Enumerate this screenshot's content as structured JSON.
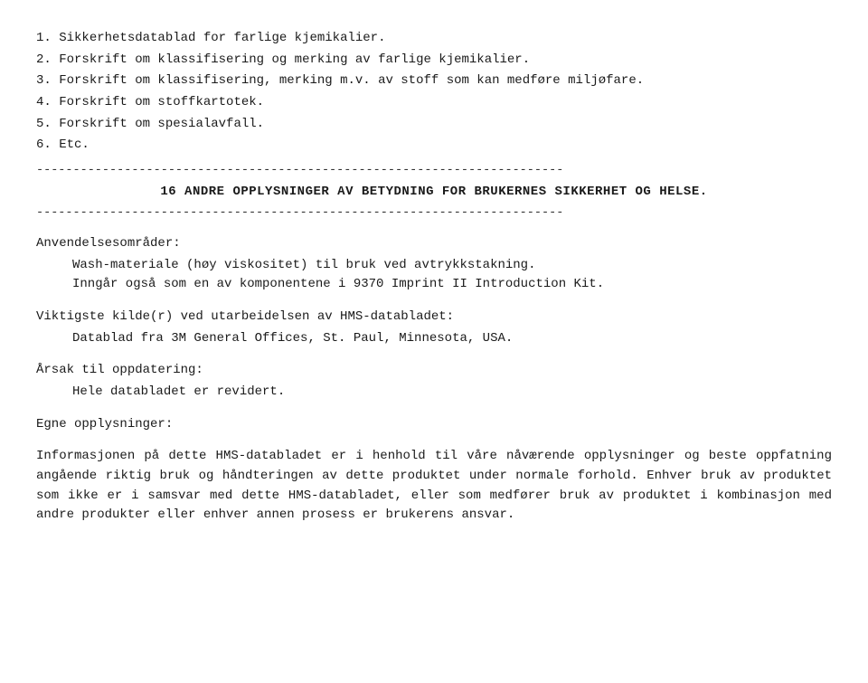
{
  "document": {
    "numbered_items": [
      {
        "number": "1.",
        "text": "Sikkerhetsdatablad for farlige kjemikalier."
      },
      {
        "number": "2.",
        "text": "Forskrift om klassifisering og merking av farlige kjemikalier."
      },
      {
        "number": "3.",
        "text": "Forskrift om klassifisering, merking m.v. av stoff som kan medføre miljøfare."
      },
      {
        "number": "4.",
        "text": "Forskrift om stoffkartotek."
      },
      {
        "number": "5.",
        "text": "Forskrift om spesialavfall."
      },
      {
        "number": "6.",
        "text": "Etc."
      }
    ],
    "dash_line": "------------------------------------------------------------------------",
    "section_title": "16 ANDRE OPPLYSNINGER AV BETYDNING FOR BRUKERNES SIKKERHET OG HELSE.",
    "application_label": "Anvendelsesområder:",
    "application_text1": "Wash-materiale (høy viskositet) til bruk ved avtrykkstakning.",
    "application_text2": "Inngår også som en av komponentene i 9370 Imprint II Introduction Kit.",
    "source_label": "Viktigste kilde(r) ved utarbeidelsen av HMS-databladet:",
    "source_text": "Datablad fra 3M General Offices, St. Paul, Minnesota, USA.",
    "update_label": "Årsak til oppdatering:",
    "update_text": "Hele databladet er revidert.",
    "own_info_label": "Egne opplysninger:",
    "disclaimer": "Informasjonen på dette HMS-databladet er i henhold til våre nåværende opplysninger og beste oppfatning angående riktig bruk og håndteringen av dette produktet under normale forhold. Enhver bruk av produktet som ikke er i samsvar med dette HMS-databladet, eller som medfører bruk av produktet i kombinasjon med andre produkter eller enhver annen prosess er brukerens ansvar."
  }
}
